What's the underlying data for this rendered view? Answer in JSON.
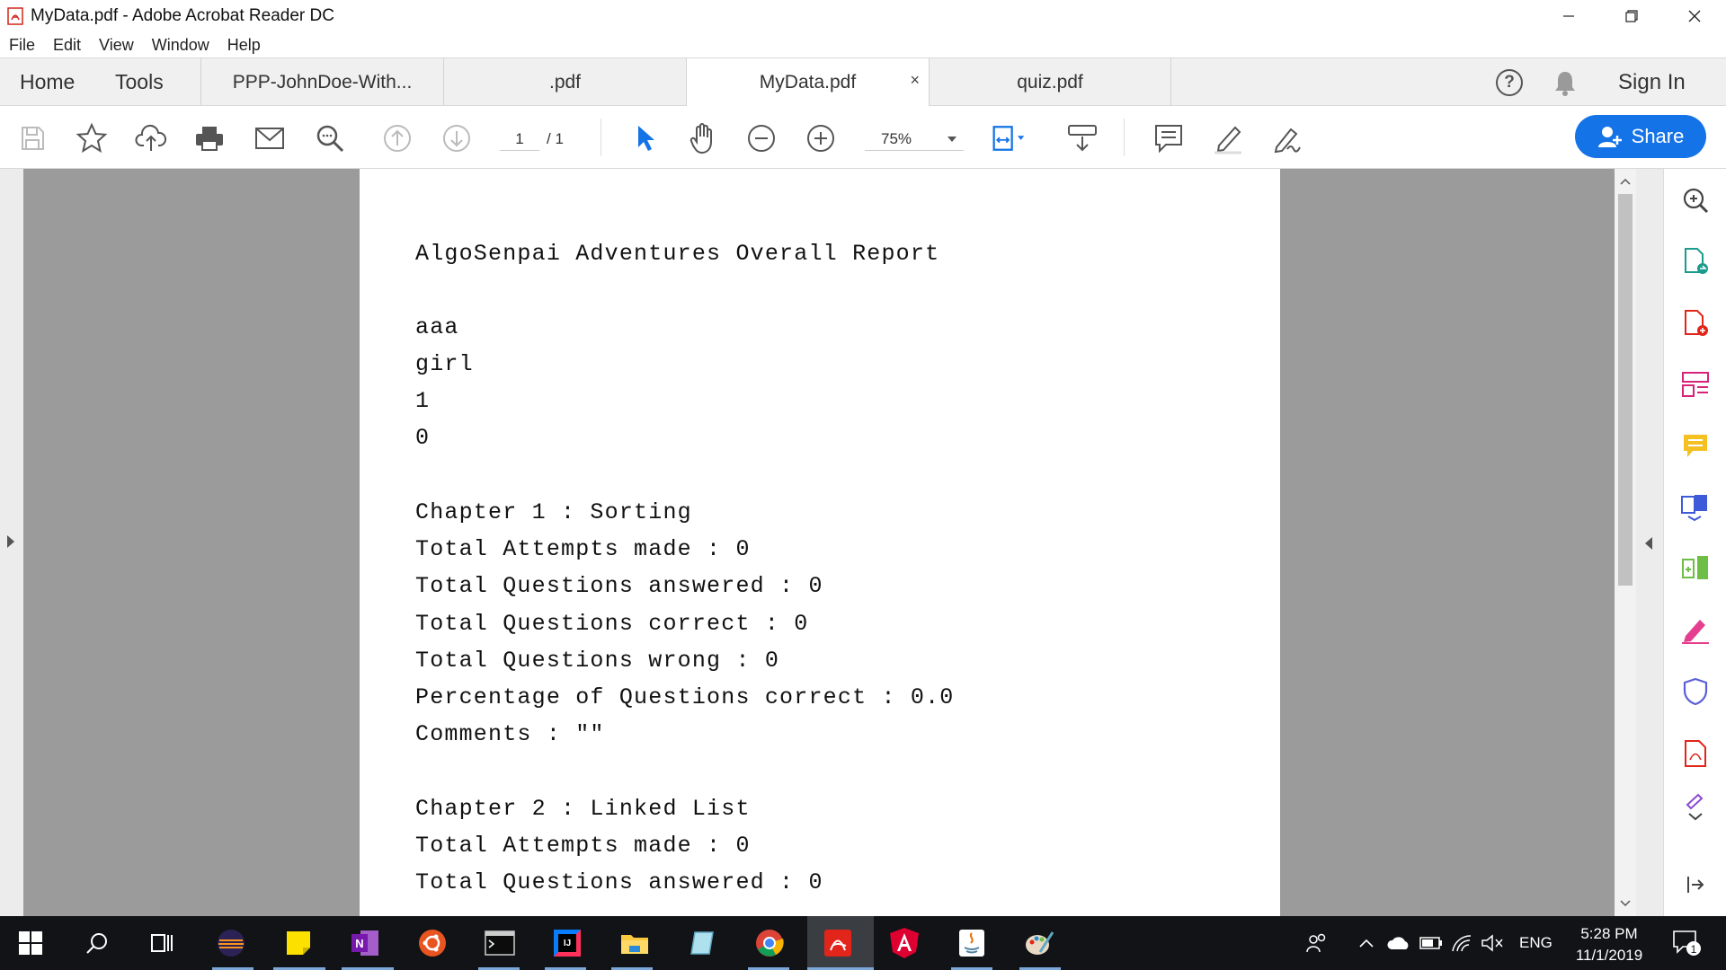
{
  "window": {
    "title": "MyData.pdf - Adobe Acrobat Reader DC",
    "icons": [
      "acrobat-icon",
      "minimize-icon",
      "restore-icon",
      "close-icon"
    ]
  },
  "menu": [
    "File",
    "Edit",
    "View",
    "Window",
    "Help"
  ],
  "tabs": {
    "home": "Home",
    "tools": "Tools",
    "documents": [
      {
        "label": "PPP-JohnDoe-With...",
        "active": false
      },
      {
        "label": ".pdf",
        "active": false
      },
      {
        "label": "MyData.pdf",
        "active": true,
        "close": "×"
      },
      {
        "label": "quiz.pdf",
        "active": false
      }
    ],
    "help": "?",
    "signin": "Sign In"
  },
  "toolbar": {
    "page_current": "1",
    "page_total": "/ 1",
    "zoom": "75%",
    "share_label": "Share",
    "accent": "#1473e6"
  },
  "document": {
    "lines": [
      "AlgoSenpai Adventures Overall Report",
      "aaa",
      "girl",
      "1",
      "0",
      "Chapter 1 : Sorting",
      "Total Attempts made : 0",
      "Total Questions answered : 0",
      "Total Questions correct : 0",
      "Total Questions wrong : 0",
      "Percentage of Questions correct : 0.0",
      "Comments : \"\"",
      "Chapter 2 : Linked List",
      "Total Attempts made : 0",
      "Total Questions answered : 0"
    ]
  },
  "taskbar": {
    "lang": "ENG",
    "time": "5:28 PM",
    "date": "11/1/2019",
    "notification_count": "1"
  }
}
